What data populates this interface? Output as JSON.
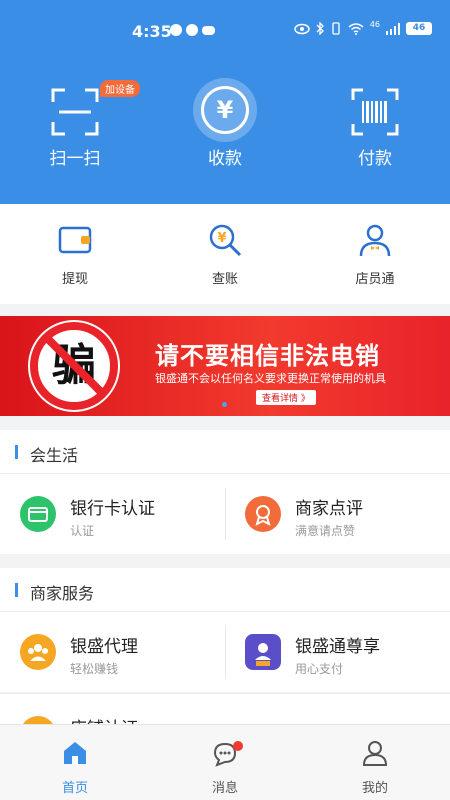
{
  "status_bar": {
    "time": "4:35",
    "network": "46",
    "battery": "46"
  },
  "top_actions": {
    "scan_label": "扫一扫",
    "add_device_badge": "加设备",
    "receive_label": "收款",
    "receive_symbol": "¥",
    "pay_label": "付款"
  },
  "quick_tools": {
    "withdraw_label": "提现",
    "check_account_label": "查账",
    "clerk_label": "店员通"
  },
  "promo": {
    "char": "骗",
    "title": "请不要相信非法电销",
    "subtitle": "银盛通不会以任何名义要求更换正常使用的机具",
    "button": "查看详情 》"
  },
  "life_section": {
    "title": "会生活",
    "cards": [
      {
        "title": "银行卡认证",
        "sub": "认证"
      },
      {
        "title": "商家点评",
        "sub": "满意请点赞"
      }
    ]
  },
  "merchant_section": {
    "title": "商家服务",
    "cards": [
      {
        "title": "银盛代理",
        "sub": "轻松赚钱"
      },
      {
        "title": "银盛通尊享",
        "sub": "用心支付"
      },
      {
        "title": "店铺认证",
        "sub": ""
      }
    ]
  },
  "bottom_nav": {
    "home": "首页",
    "messages": "消息",
    "mine": "我的"
  },
  "colors": {
    "primary": "#3a8ee6",
    "promo_red": "#e8232a",
    "badge_red": "#f23a2e"
  }
}
